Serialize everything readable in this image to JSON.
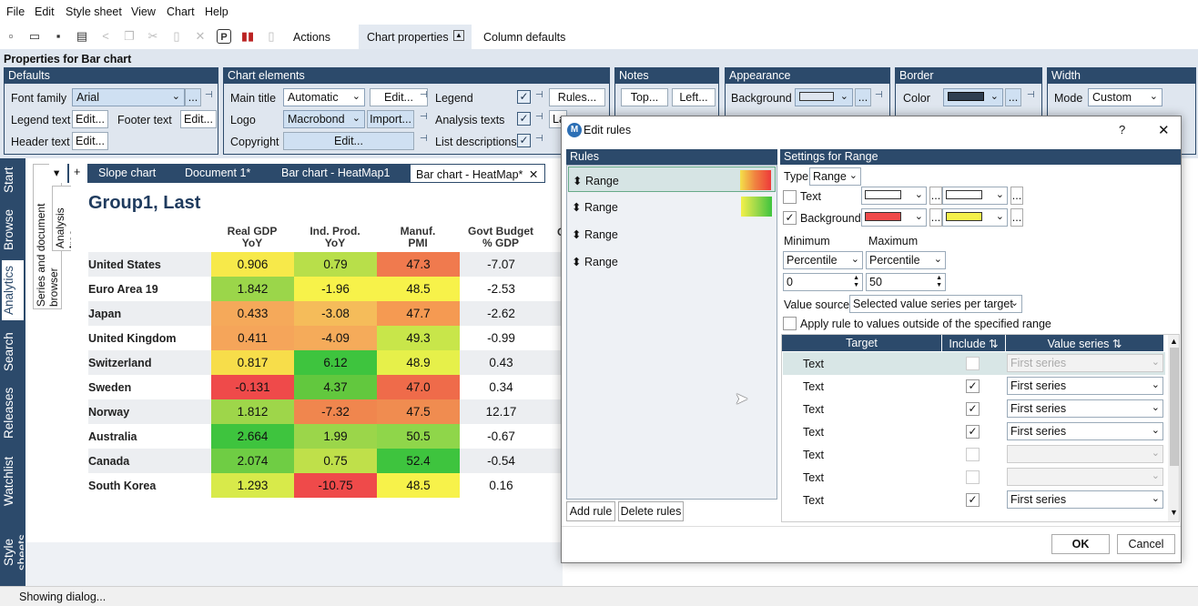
{
  "menu": [
    "File",
    "Edit",
    "Style sheet",
    "View",
    "Chart",
    "Help"
  ],
  "ribbon_tabs": {
    "actions": "Actions",
    "chart_properties": "Chart properties",
    "column_defaults": "Column defaults"
  },
  "props_title": "Properties for Bar chart",
  "defaults": {
    "header": "Defaults",
    "font_family_label": "Font family",
    "font_family_value": "Arial",
    "legend_text_label": "Legend text",
    "footer_text_label": "Footer text",
    "header_text_label": "Header text",
    "edit": "Edit...",
    "more": "..."
  },
  "chart_elements": {
    "header": "Chart elements",
    "main_title_label": "Main title",
    "main_title_value": "Automatic",
    "logo_label": "Logo",
    "logo_value": "Macrobond",
    "import": "Import...",
    "copyright_label": "Copyright",
    "edit": "Edit...",
    "legend_label": "Legend",
    "analysis_texts_label": "Analysis texts",
    "list_descriptions_label": "List descriptions",
    "rules": "Rules...",
    "la": "La"
  },
  "notes": {
    "header": "Notes",
    "top": "Top...",
    "left": "Left..."
  },
  "appearance": {
    "header": "Appearance",
    "background_label": "Background",
    "more": "...",
    "background_color": "#dfe6ef"
  },
  "border": {
    "header": "Border",
    "color_label": "Color",
    "more": "...",
    "color": "#2f3e50"
  },
  "width": {
    "header": "Width",
    "mode_label": "Mode",
    "mode_value": "Custom"
  },
  "left_tabs": [
    "Start",
    "Browse",
    "Analytics",
    "Search",
    "Releases",
    "Watchlist",
    "Style sheets"
  ],
  "side_tabs": [
    "Series and document browser",
    "Analysis tree"
  ],
  "doc_tabs": {
    "down": "▾",
    "plus": "+",
    "tabs": [
      "Slope chart",
      "Document 1*",
      "Bar chart - HeatMap1",
      "Bar chart - HeatMap*"
    ],
    "close": "✕"
  },
  "heatmap": {
    "title": "Group1, Last",
    "columns": [
      [
        "Real GDP",
        "YoY"
      ],
      [
        "Ind. Prod.",
        "YoY"
      ],
      [
        "Manuf.",
        "PMI"
      ],
      [
        "Govt Budget",
        "% GDP"
      ]
    ],
    "col5_partial": "G",
    "rows": [
      {
        "label": "United States",
        "values": [
          "0.906",
          "0.79",
          "47.3",
          "-7.07"
        ],
        "colors": [
          "#f7e94a",
          "#b8df4a",
          "#f07a4e",
          ""
        ]
      },
      {
        "label": "Euro Area 19",
        "values": [
          "1.842",
          "-1.96",
          "48.5",
          "-2.53"
        ],
        "colors": [
          "#9bd64a",
          "#f7f24a",
          "#f7f24a",
          ""
        ]
      },
      {
        "label": "Japan",
        "values": [
          "0.433",
          "-3.08",
          "47.7",
          "-2.62"
        ],
        "colors": [
          "#f5a95a",
          "#f5bc5a",
          "#f59a52",
          ""
        ]
      },
      {
        "label": "United Kingdom",
        "values": [
          "0.411",
          "-4.09",
          "49.3",
          "-0.99"
        ],
        "colors": [
          "#f5a55a",
          "#f5ab5a",
          "#c8e64a",
          ""
        ]
      },
      {
        "label": "Switzerland",
        "values": [
          "0.817",
          "6.12",
          "48.9",
          "0.43"
        ],
        "colors": [
          "#f7dd4a",
          "#3ec43e",
          "#e6f04a",
          ""
        ]
      },
      {
        "label": "Sweden",
        "values": [
          "-0.131",
          "4.37",
          "47.0",
          "0.34"
        ],
        "colors": [
          "#ef4a4a",
          "#62c83e",
          "#ef6b4a",
          ""
        ]
      },
      {
        "label": "Norway",
        "values": [
          "1.812",
          "-7.32",
          "47.5",
          "12.17"
        ],
        "colors": [
          "#9ed64a",
          "#f0864e",
          "#f08c50",
          ""
        ]
      },
      {
        "label": "Australia",
        "values": [
          "2.664",
          "1.99",
          "50.5",
          "-0.67"
        ],
        "colors": [
          "#3ec43e",
          "#9bd64a",
          "#8fd64a",
          ""
        ]
      },
      {
        "label": "Canada",
        "values": [
          "2.074",
          "0.75",
          "52.4",
          "-0.54"
        ],
        "colors": [
          "#6fcd44",
          "#bfe04a",
          "#3ec43e",
          ""
        ]
      },
      {
        "label": "South Korea",
        "values": [
          "1.293",
          "-10.75",
          "48.5",
          "0.16"
        ],
        "colors": [
          "#d8ea4a",
          "#ef4a4a",
          "#f7f24a",
          ""
        ]
      }
    ]
  },
  "status": "Showing dialog...",
  "dialog": {
    "title": "Edit rules",
    "help": "?",
    "close": "✕",
    "rules_header": "Rules",
    "rules": [
      "Range",
      "Range",
      "Range",
      "Range"
    ],
    "add_rule": "Add rule",
    "delete_rules": "Delete rules",
    "settings_header": "Settings for Range",
    "type_label": "Type",
    "type_value": "Range",
    "text_label": "Text",
    "background_label": "Background",
    "more": "...",
    "minimum_label": "Minimum",
    "maximum_label": "Maximum",
    "min_mode": "Percentile",
    "max_mode": "Percentile",
    "min_value": "0",
    "max_value": "50",
    "value_source_label": "Value source",
    "value_source_value": "Selected value series per target",
    "apply_outside_label": "Apply rule to values outside of the specified range",
    "table_headers": [
      "Target",
      "Include",
      "Value series"
    ],
    "targets": [
      {
        "target": "Text",
        "include": false,
        "series": "First series",
        "disabled": true
      },
      {
        "target": "Text",
        "include": true,
        "series": "First series",
        "disabled": false
      },
      {
        "target": "Text",
        "include": true,
        "series": "First series",
        "disabled": false
      },
      {
        "target": "Text",
        "include": true,
        "series": "First series",
        "disabled": false
      },
      {
        "target": "Text",
        "include": false,
        "series": "",
        "disabled": true
      },
      {
        "target": "Text",
        "include": false,
        "series": "",
        "disabled": true
      },
      {
        "target": "Text",
        "include": true,
        "series": "First series",
        "disabled": false
      }
    ],
    "ok": "OK",
    "cancel": "Cancel"
  }
}
